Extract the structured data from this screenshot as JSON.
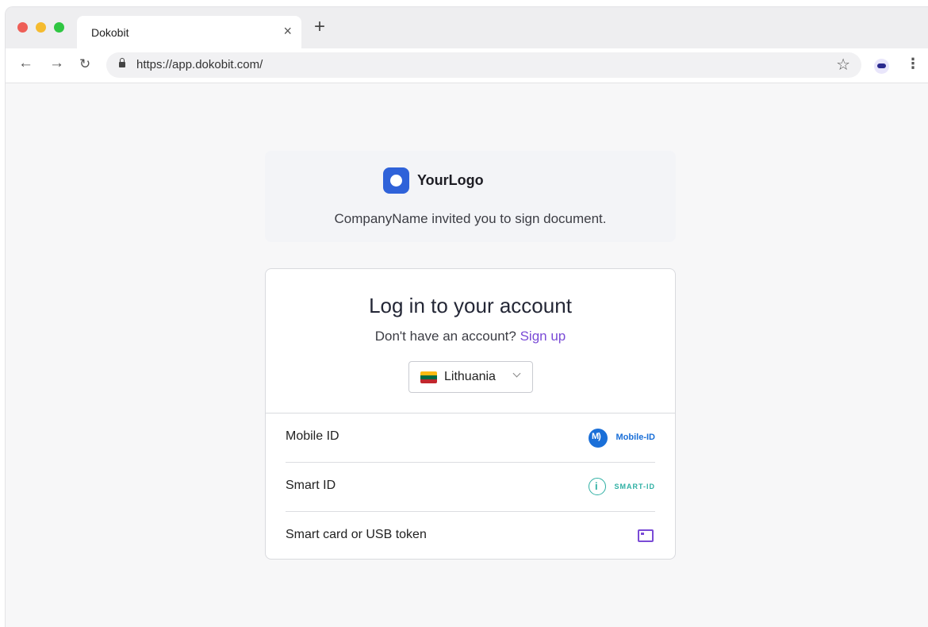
{
  "browser": {
    "tab_title": "Dokobit",
    "tab_close": "×",
    "new_tab": "+",
    "url": "https://app.dokobit.com/",
    "icons": [
      "back-arrow-icon",
      "forward-arrow-icon",
      "reload-icon",
      "lock-icon",
      "star-icon",
      "extension-icon",
      "menu-dots-icon"
    ]
  },
  "invite": {
    "logo_text": "YourLogo",
    "message": "CompanyName invited you to sign document."
  },
  "login": {
    "title": "Log in to your account",
    "no_account_text": "Don't have an account?",
    "signup_label": "Sign up",
    "country": "Lithuania",
    "flag_colors": [
      "#FDB913",
      "#006A44",
      "#C1272D"
    ],
    "methods": [
      {
        "label": "Mobile ID",
        "logo_text": "Mobile-ID"
      },
      {
        "label": "Smart ID",
        "logo_text": "SMART-ID"
      },
      {
        "label": "Smart card or USB token"
      }
    ]
  },
  "colors": {
    "accent": "#7a4bd6",
    "logo_blue": "#2f62d9",
    "mobile_id_blue": "#1a6fd8",
    "smart_id_teal": "#2fb0a4"
  }
}
